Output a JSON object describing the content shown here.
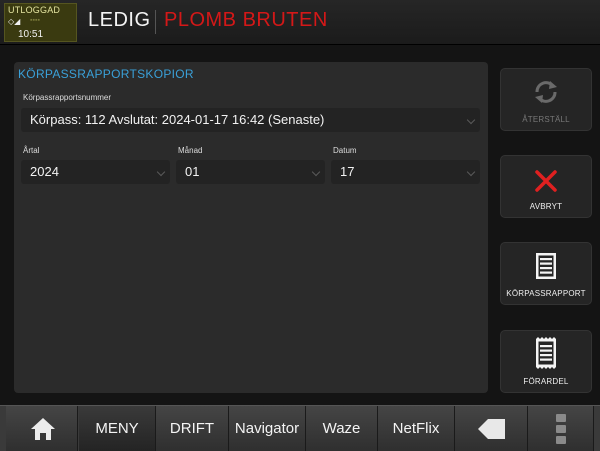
{
  "header": {
    "login_status": "UTLOGGAD",
    "time": "10:51",
    "status": "LEDIG",
    "alert": "PLOMB BRUTEN",
    "alert_color": "#d41818"
  },
  "panel": {
    "title": "KÖRPASSRAPPORTSKOPIOR",
    "title_color": "#3aa0d8",
    "report_number": {
      "label": "Körpassrapportsnummer",
      "value": "Körpass: 112  Avslutat: 2024-01-17 16:42  (Senaste)"
    },
    "year": {
      "label": "Årtal",
      "value": "2024"
    },
    "month": {
      "label": "Månad",
      "value": "01"
    },
    "day": {
      "label": "Datum",
      "value": "17"
    }
  },
  "side_buttons": {
    "restore": {
      "label": "ÅTERSTÄLL",
      "icon": "refresh-icon",
      "enabled": false
    },
    "cancel": {
      "label": "AVBRYT",
      "icon": "close-icon"
    },
    "report": {
      "label": "KÖRPASSRAPPORT",
      "icon": "document-icon"
    },
    "draft": {
      "label": "FÖRARDEL",
      "icon": "receipt-icon"
    }
  },
  "bottom_nav": {
    "home_icon": "home-icon",
    "menu": "MENY",
    "drift": "DRIFT",
    "navigator": "Navigator",
    "waze": "Waze",
    "netflix": "NetFlix",
    "back_icon": "back-arrow-icon",
    "more_icon": "more-vertical-icon"
  }
}
